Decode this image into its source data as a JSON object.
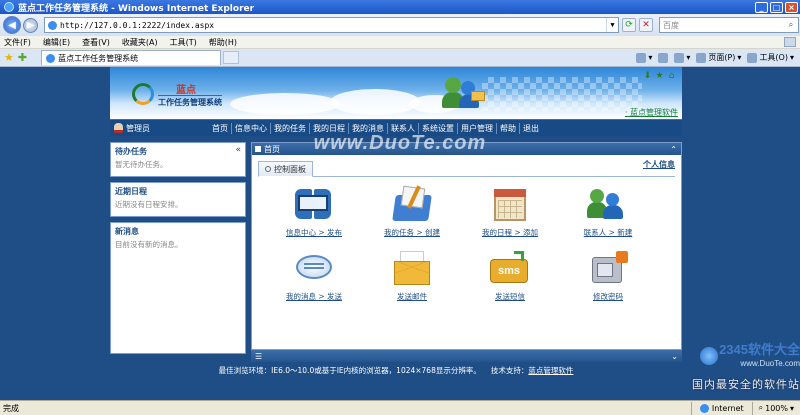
{
  "window": {
    "title": "蓝点工作任务管理系统 - Windows Internet Explorer",
    "controls": [
      "_",
      "□",
      "×"
    ]
  },
  "address_bar": {
    "url": "http://127.0.0.1:2222/index.aspx",
    "search_placeholder": "百度"
  },
  "menu": [
    "文件(F)",
    "编辑(E)",
    "查看(V)",
    "收藏夹(A)",
    "工具(T)",
    "帮助(H)"
  ],
  "tab": {
    "title": "蓝点工作任务管理系统"
  },
  "command_bar": {
    "page": "页面(P)",
    "tools": "工具(O)"
  },
  "app": {
    "brand": "蓝点",
    "subtitle": "工作任务管理系统",
    "product_link": "· 蓝点管理软件",
    "user": "管理员",
    "nav": [
      "首页",
      "信息中心",
      "我的任务",
      "我的日程",
      "我的消息",
      "联系人",
      "系统设置",
      "用户管理",
      "帮助",
      "退出"
    ]
  },
  "left_panels": [
    {
      "title": "待办任务",
      "content": "暂无待办任务。",
      "collapse": "«"
    },
    {
      "title": "近期日程",
      "content": "近期没有日程安排。"
    },
    {
      "title": "新消息",
      "content": "目前没有新的消息。"
    }
  ],
  "main": {
    "header": "首页",
    "tab": "控制面板",
    "personal_info": "个人信息",
    "shortcuts": [
      {
        "icon": "info-center-icon",
        "label": "信息中心 > 发布"
      },
      {
        "icon": "my-tasks-icon",
        "label": "我的任务 > 创建"
      },
      {
        "icon": "my-schedule-icon",
        "label": "我的日程 > 添加"
      },
      {
        "icon": "contacts-icon",
        "label": "联系人 > 新建"
      },
      {
        "icon": "my-messages-icon",
        "label": "我的消息 > 发送"
      },
      {
        "icon": "send-mail-icon",
        "label": "发送邮件"
      },
      {
        "icon": "send-sms-icon",
        "label": "发送短信"
      },
      {
        "icon": "change-password-icon",
        "label": "修改密码"
      }
    ],
    "sms_text": "sms"
  },
  "footer": {
    "browser_note": "最佳浏览环境：IE6.0～10.0或基于IE内核的浏览器，1024×768显示分辨率。",
    "tech_label": "技术支持：",
    "tech_link": "蓝点管理软件"
  },
  "status_bar": {
    "left": "完成",
    "zone": "Internet",
    "zoom": "100%"
  },
  "watermarks": {
    "center": "www.DuoTe.com",
    "corner_top": "2345软件大全",
    "corner_url": "www.DuoTe.com",
    "corner_bottom": "国内最安全的软件站"
  }
}
